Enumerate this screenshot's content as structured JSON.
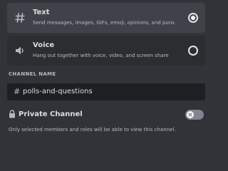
{
  "channel_types": [
    {
      "title": "Text",
      "description": "Send messages, images, GIFs, emoji, opinions, and puns",
      "icon": "hash-icon",
      "selected": true
    },
    {
      "title": "Voice",
      "description": "Hang out together with voice, video, and screen share",
      "icon": "speaker-icon",
      "selected": false
    }
  ],
  "channel_name": {
    "label": "CHANNEL NAME",
    "prefix": "#",
    "value": "polls-and-questions"
  },
  "private_channel": {
    "label": "Private Channel",
    "icon": "lock-icon",
    "enabled": false,
    "description": "Only selected members and roles will be able to view this channel."
  },
  "colors": {
    "background": "#313338",
    "selected_option": "#404249",
    "option": "#2b2d31",
    "input": "#1e1f22",
    "text_primary": "#dbdee1",
    "text_secondary": "#b5bac1",
    "toggle_off": "#80848e"
  }
}
